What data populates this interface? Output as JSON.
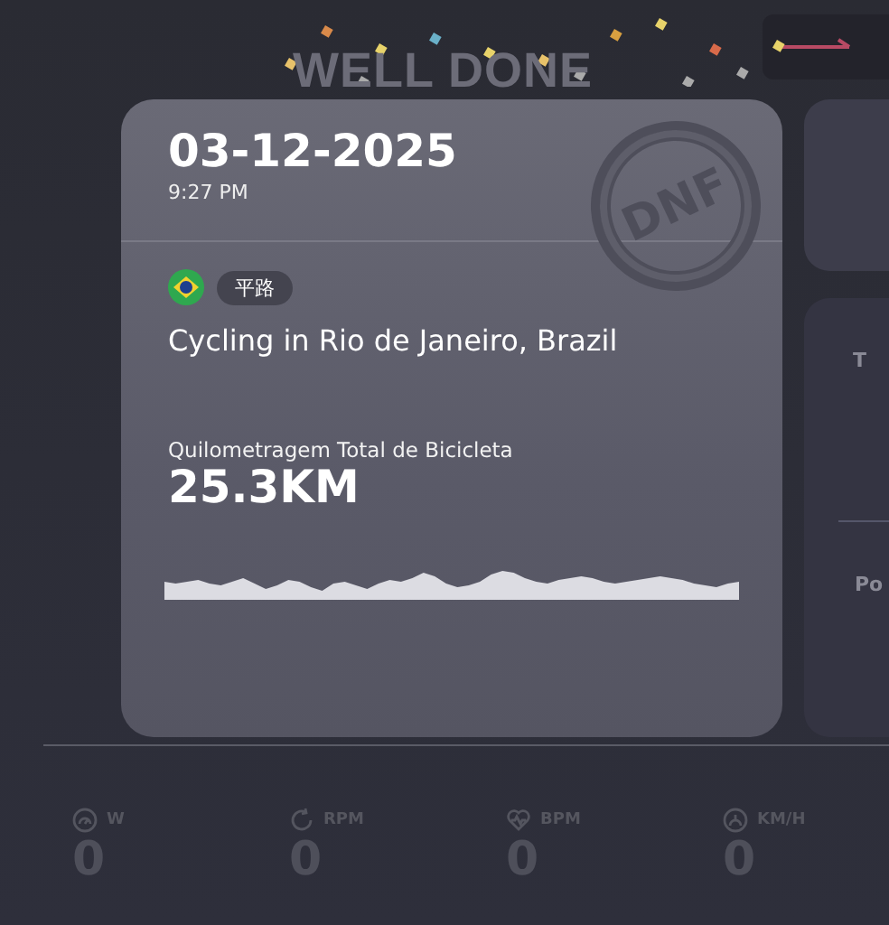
{
  "header": {
    "title": "WELL DONE"
  },
  "activity": {
    "date": "03-12-2025",
    "time": "9:27 PM",
    "status_stamp": "DNF",
    "terrain_tag": "平路",
    "title": "Cycling in Rio de Janeiro, Brazil",
    "distance_label": "Quilometragem Total de Bicicleta",
    "distance_value": "25.3KM"
  },
  "side_panel": {
    "text_1": "T",
    "text_2": "Po"
  },
  "stats": [
    {
      "kind": "power",
      "unit": "W",
      "value": "0"
    },
    {
      "kind": "cadence",
      "unit": "RPM",
      "value": "0"
    },
    {
      "kind": "heart",
      "unit": "BPM",
      "value": "0"
    },
    {
      "kind": "speed",
      "unit": "KM/H",
      "value": "0"
    }
  ]
}
